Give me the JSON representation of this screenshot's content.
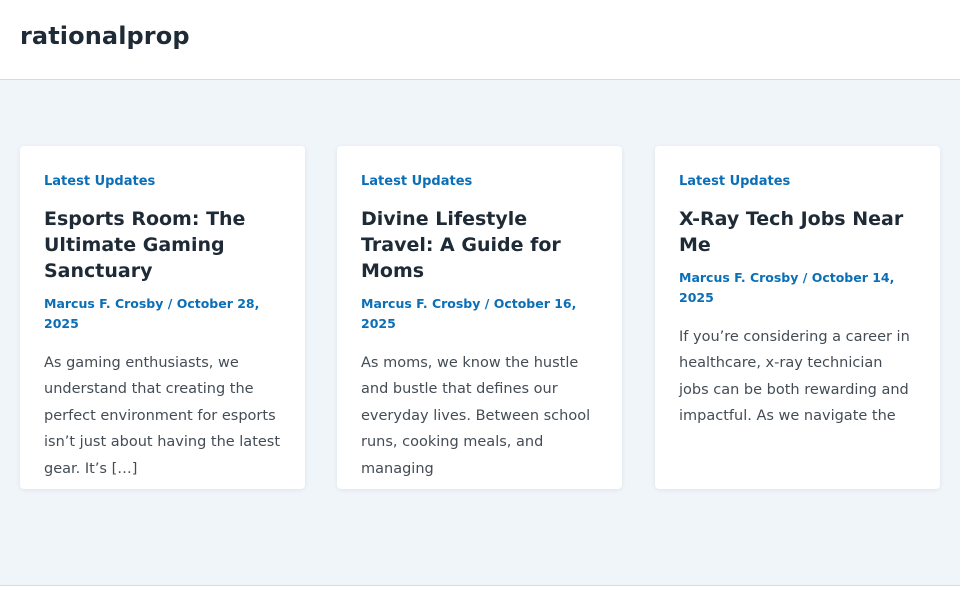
{
  "site": {
    "title": "rationalprop"
  },
  "posts": [
    {
      "category": "Latest Updates",
      "title": "Esports Room: The Ultimate Gaming Sanctuary",
      "author": "Marcus F. Crosby",
      "separator": " / ",
      "date": "October 28, 2025",
      "excerpt": "As gaming enthusiasts, we understand that creating the perfect environment for esports isn’t just about having the latest gear. It’s […]"
    },
    {
      "category": "Latest Updates",
      "title": "Divine Lifestyle Travel: A Guide for Moms",
      "author": "Marcus F. Crosby",
      "separator": " / ",
      "date": "October 16, 2025",
      "excerpt": "As moms, we know the hustle and bustle that defines our everyday lives. Between school runs, cooking meals, and managing"
    },
    {
      "category": "Latest Updates",
      "title": "X-Ray Tech Jobs Near Me",
      "author": "Marcus F. Crosby",
      "separator": " / ",
      "date": "October 14, 2025",
      "excerpt": "If you’re considering a career in healthcare, x-ray technician jobs can be both rewarding and impactful. As we navigate the"
    }
  ],
  "colors": {
    "accent": "#0b6fb8",
    "heading": "#1e2b37",
    "body_text": "#444c55",
    "page_background": "#f0f5fa"
  }
}
